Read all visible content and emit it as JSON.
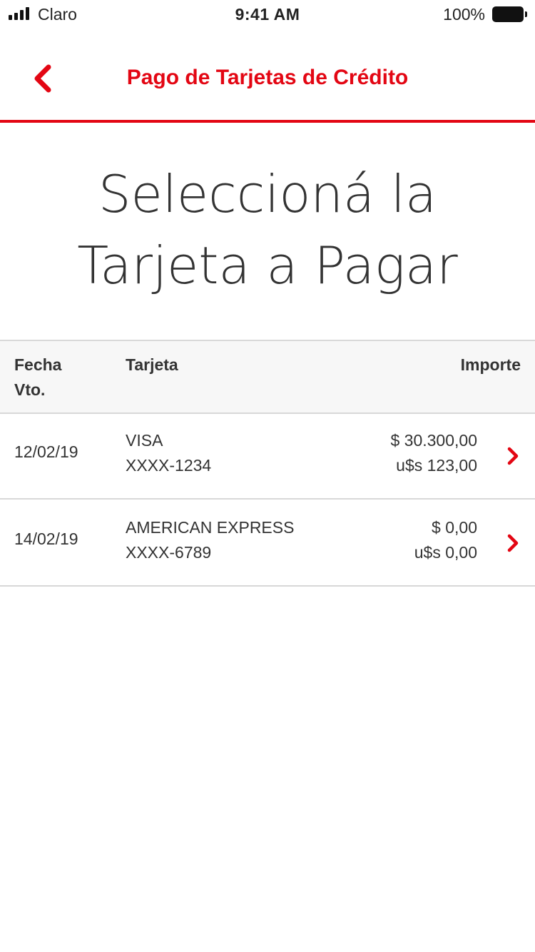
{
  "status_bar": {
    "carrier": "Claro",
    "time": "9:41 AM",
    "battery": "100%"
  },
  "nav": {
    "title": "Pago de Tarjetas de Crédito",
    "back_icon": "chevron-left-icon"
  },
  "page": {
    "title_line1": "Seleccioná la",
    "title_line2": "Tarjeta a Pagar"
  },
  "table": {
    "headers": {
      "fecha_line1": "Fecha",
      "fecha_line2": "Vto.",
      "tarjeta": "Tarjeta",
      "importe": "Importe"
    },
    "rows": [
      {
        "date": "12/02/19",
        "card_name": "VISA",
        "card_number": "XXXX-1234",
        "amount_ars": "$ 30.300,00",
        "amount_usd": "u$s 123,00"
      },
      {
        "date": "14/02/19",
        "card_name": "AMERICAN EXPRESS",
        "card_number": "XXXX-6789",
        "amount_ars": "$ 0,00",
        "amount_usd": "u$s 0,00"
      }
    ]
  },
  "colors": {
    "accent": "#e30613",
    "text": "#333333",
    "header_bg": "#f7f7f7",
    "divider": "#d8d8d8"
  }
}
